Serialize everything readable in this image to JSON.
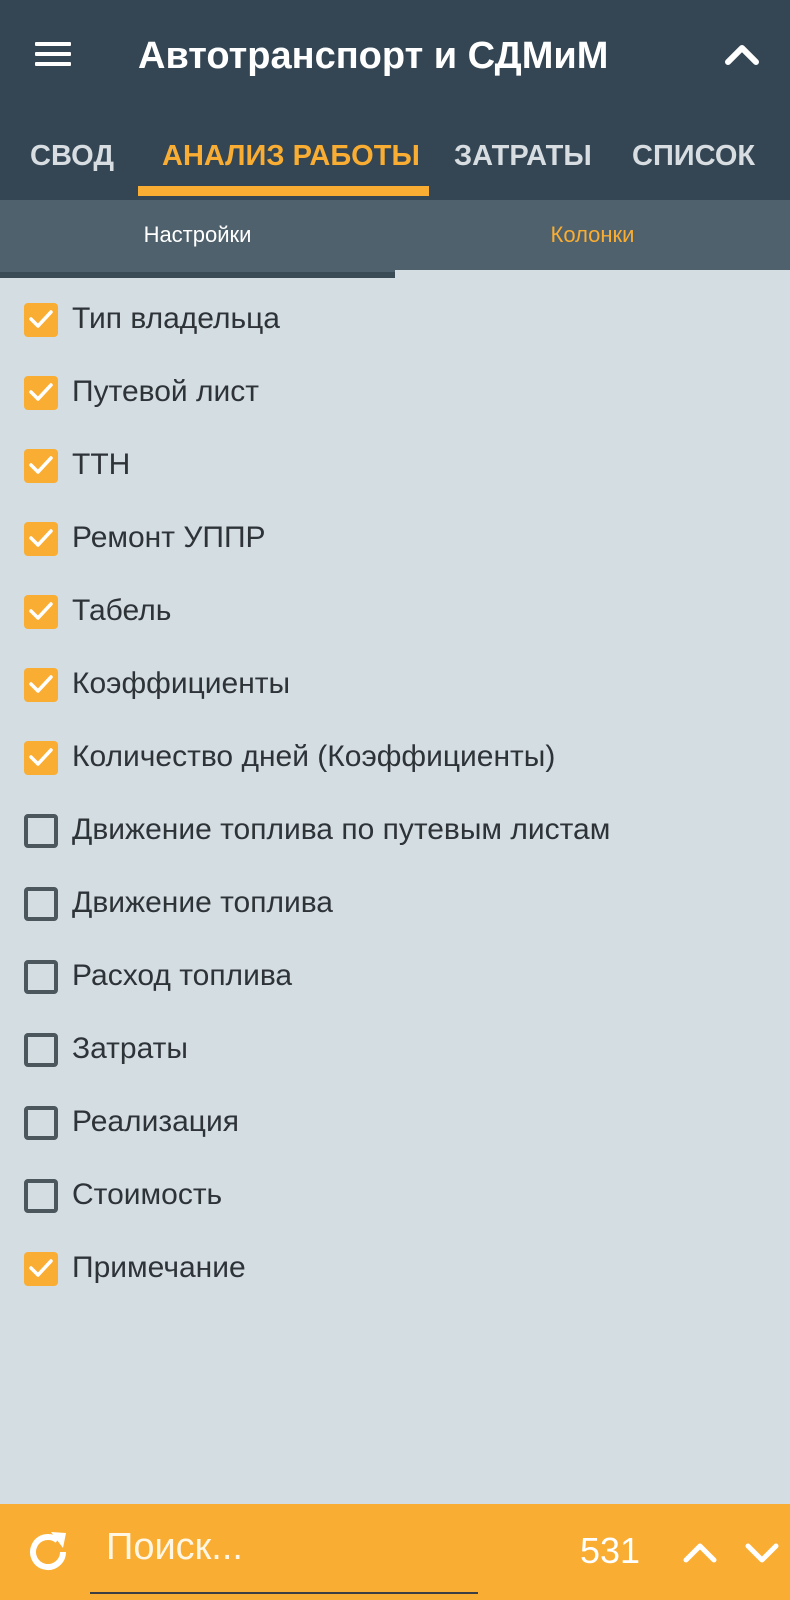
{
  "header": {
    "title": "Автотранспорт и СДМиМ",
    "menu_icon": "hamburger-menu-icon",
    "collapse_icon": "chevron-up-icon"
  },
  "tabs": [
    {
      "label": "СВОД",
      "active": false
    },
    {
      "label": "АНАЛИЗ РАБОТЫ",
      "active": true
    },
    {
      "label": "ЗАТРАТЫ",
      "active": false
    },
    {
      "label": "СПИСОК",
      "active": false
    }
  ],
  "subtabs": [
    {
      "label": "Настройки"
    },
    {
      "label": "Колонки"
    }
  ],
  "columns": [
    {
      "label": "Тип владельца",
      "checked": true
    },
    {
      "label": "Путевой лист",
      "checked": true
    },
    {
      "label": "ТТН",
      "checked": true
    },
    {
      "label": "Ремонт УППР",
      "checked": true
    },
    {
      "label": "Табель",
      "checked": true
    },
    {
      "label": "Коэффициенты",
      "checked": true
    },
    {
      "label": "Количество дней (Коэффициенты)",
      "checked": true
    },
    {
      "label": "Движение топлива по путевым листам",
      "checked": false
    },
    {
      "label": "Движение топлива",
      "checked": false
    },
    {
      "label": "Расход топлива",
      "checked": false
    },
    {
      "label": "Затраты",
      "checked": false
    },
    {
      "label": "Реализация",
      "checked": false
    },
    {
      "label": "Стоимость",
      "checked": false
    },
    {
      "label": "Примечание",
      "checked": true
    }
  ],
  "bottom": {
    "search_placeholder": "Поиск...",
    "search_value": "",
    "count": "531",
    "refresh_icon": "refresh-icon",
    "prev_icon": "chevron-up-icon",
    "next_icon": "chevron-down-icon"
  },
  "colors": {
    "appbar": "#344654",
    "accent": "#f9ad32",
    "subtabs": "#4f616d",
    "background": "#d3dde2",
    "text": "#2e3338"
  }
}
